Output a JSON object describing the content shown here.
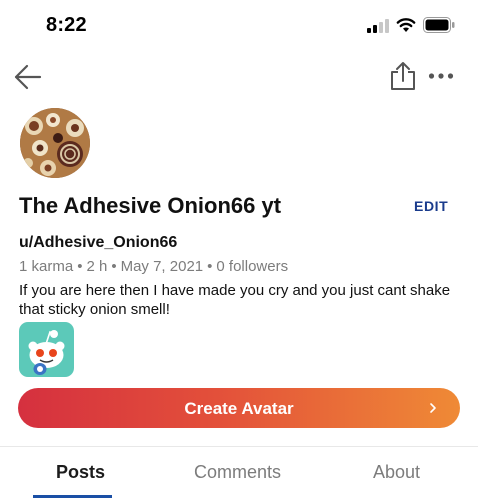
{
  "status_bar": {
    "time": "8:22"
  },
  "nav": {
    "icons": [
      "back-arrow-icon",
      "share-icon",
      "more-options-icon"
    ]
  },
  "profile": {
    "display_name": "The Adhesive Onion66 yt",
    "edit_label": "EDIT",
    "username": "u/Adhesive_Onion66",
    "stats": {
      "karma": "1 karma",
      "age": "2 h",
      "date": "May 7, 2021",
      "followers": "0 followers"
    },
    "bio": "If you are here then I have made you cry and you just cant shake that sticky onion smell!"
  },
  "create_avatar": {
    "label": "Create Avatar"
  },
  "tabs": [
    {
      "label": "Posts",
      "active": true
    },
    {
      "label": "Comments",
      "active": false
    },
    {
      "label": "About",
      "active": false
    }
  ],
  "colors": {
    "accent_blue": "#1a4fa5",
    "edit_blue": "#1a3b8c",
    "gradient_start": "#d5303f",
    "gradient_end": "#ef8a36",
    "muted_text": "#7c7c7c"
  }
}
